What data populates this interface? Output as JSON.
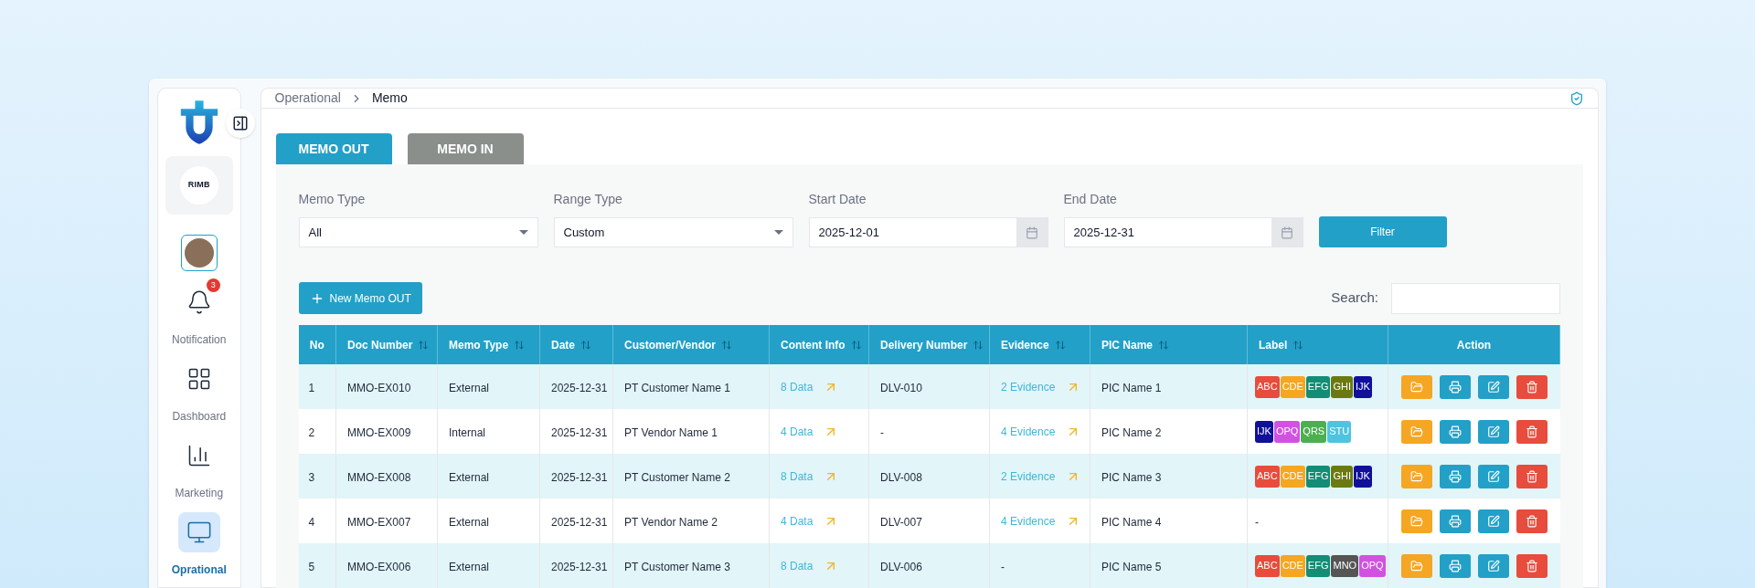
{
  "sidebar": {
    "company": "RIMB",
    "notification_badge": "3",
    "items": [
      {
        "label": "Notification",
        "selected": false
      },
      {
        "label": "Dashboard",
        "selected": false
      },
      {
        "label": "Marketing",
        "selected": false
      },
      {
        "label": "Oprational",
        "selected": true
      }
    ]
  },
  "breadcrumb": [
    "Operational",
    "Memo"
  ],
  "tabs": [
    {
      "label": "MEMO OUT",
      "selected": true
    },
    {
      "label": "MEMO IN",
      "selected": false
    }
  ],
  "filters": [
    {
      "kind": "select",
      "label": "Memo Type",
      "value": "All"
    },
    {
      "kind": "select",
      "label": "Range Type",
      "value": "Custom"
    },
    {
      "kind": "date",
      "label": "Start Date",
      "value": "2025-12-01"
    },
    {
      "kind": "date",
      "label": "End Date",
      "value": "2025-12-31"
    }
  ],
  "filter_button": "Filter",
  "new_button": "New Memo OUT",
  "search": {
    "label": "Search:"
  },
  "table": {
    "columns": [
      {
        "label": "No",
        "sortable": false
      },
      {
        "label": "Doc Number",
        "sortable": true
      },
      {
        "label": "Memo Type",
        "sortable": true
      },
      {
        "label": "Date",
        "sortable": true
      },
      {
        "label": "Customer/Vendor",
        "sortable": true
      },
      {
        "label": "Content Info",
        "sortable": true
      },
      {
        "label": "Delivery Number",
        "sortable": true
      },
      {
        "label": "Evidence",
        "sortable": true
      },
      {
        "label": "PIC Name",
        "sortable": true
      },
      {
        "label": "Label",
        "sortable": true
      },
      {
        "label": "Action",
        "sortable": false
      }
    ],
    "rows": [
      {
        "no": "1",
        "doc": "MMO-EX010",
        "memo_type": "External",
        "date": "2025-12-31",
        "party": "PT Customer Name 1",
        "content": {
          "text": "8 Data",
          "link": true
        },
        "delivery": "DLV-010",
        "evidence": {
          "text": "2 Evidence",
          "link": true
        },
        "pic": "PIC Name 1",
        "labels": [
          {
            "text": "ABC",
            "color": "#e74c3c"
          },
          {
            "text": "CDE",
            "color": "#f5a623"
          },
          {
            "text": "EFG",
            "color": "#138d75"
          },
          {
            "text": "GHI",
            "color": "#6b7a10"
          },
          {
            "text": "IJK",
            "color": "#10109a"
          }
        ]
      },
      {
        "no": "2",
        "doc": "MMO-EX009",
        "memo_type": "Internal",
        "date": "2025-12-31",
        "party": "PT Vendor Name 1",
        "content": {
          "text": "4 Data",
          "link": true
        },
        "delivery": "-",
        "evidence": {
          "text": "4 Evidence",
          "link": true
        },
        "pic": "PIC Name 2",
        "labels": [
          {
            "text": "IJK",
            "color": "#10109a"
          },
          {
            "text": "OPQ",
            "color": "#d152e0"
          },
          {
            "text": "QRS",
            "color": "#4caf50"
          },
          {
            "text": "STU",
            "color": "#4fc3e0"
          }
        ]
      },
      {
        "no": "3",
        "doc": "MMO-EX008",
        "memo_type": "External",
        "date": "2025-12-31",
        "party": "PT Customer Name 2",
        "content": {
          "text": "8 Data",
          "link": true
        },
        "delivery": "DLV-008",
        "evidence": {
          "text": "2 Evidence",
          "link": true
        },
        "pic": "PIC Name 3",
        "labels": [
          {
            "text": "ABC",
            "color": "#e74c3c"
          },
          {
            "text": "CDE",
            "color": "#f5a623"
          },
          {
            "text": "EFG",
            "color": "#138d75"
          },
          {
            "text": "GHI",
            "color": "#6b7a10"
          },
          {
            "text": "IJK",
            "color": "#10109a"
          }
        ]
      },
      {
        "no": "4",
        "doc": "MMO-EX007",
        "memo_type": "External",
        "date": "2025-12-31",
        "party": "PT Vendor Name 2",
        "content": {
          "text": "4 Data",
          "link": true
        },
        "delivery": "DLV-007",
        "evidence": {
          "text": "4 Evidence",
          "link": true
        },
        "pic": "PIC Name 4",
        "label_text": "-"
      },
      {
        "no": "5",
        "doc": "MMO-EX006",
        "memo_type": "External",
        "date": "2025-12-31",
        "party": "PT Customer Name 3",
        "content": {
          "text": "8 Data",
          "link": true
        },
        "delivery": "DLV-006",
        "evidence": {
          "text": "-",
          "link": false
        },
        "pic": "PIC Name 5",
        "labels": [
          {
            "text": "ABC",
            "color": "#e74c3c"
          },
          {
            "text": "CDE",
            "color": "#f5a623"
          },
          {
            "text": "EFG",
            "color": "#138d75"
          },
          {
            "text": "MNO",
            "color": "#555555"
          },
          {
            "text": "OPQ",
            "color": "#d152e0"
          }
        ]
      }
    ]
  }
}
